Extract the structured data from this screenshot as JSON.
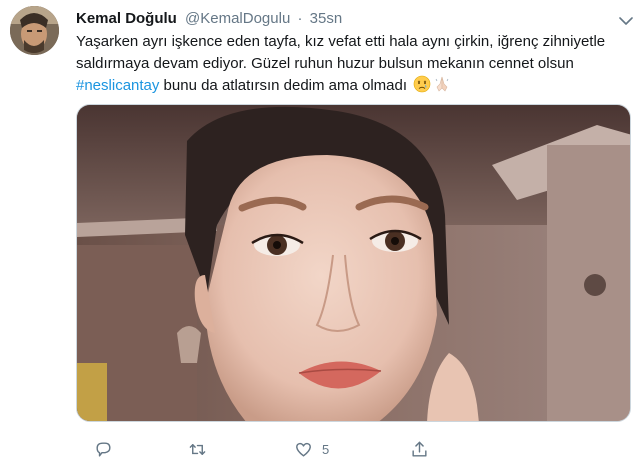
{
  "tweet": {
    "author": {
      "display_name": "Kemal Doğulu",
      "handle": "@KemalDogulu"
    },
    "separator": "·",
    "time": "35sn",
    "text": {
      "part1": "Yaşarken ayrı işkence eden tayfa, kız vefat etti hala aynı çirkin, iğrenç zihniyetle saldırmaya devam ediyor. Güzel ruhun huzur bulsun mekanın cennet olsun ",
      "hashtag": "#neslicantay",
      "part2": " bunu da atlatırsın dedim ama olmadı"
    },
    "emojis": [
      "crying-face",
      "folded-hands"
    ],
    "media": {
      "alt": "photo"
    },
    "actions": {
      "reply_count": "",
      "retweet_count": "",
      "like_count": "5"
    }
  },
  "colors": {
    "link": "#1b95e0",
    "secondary": "#657786",
    "text": "#14171a",
    "border": "#ccd6dd"
  }
}
